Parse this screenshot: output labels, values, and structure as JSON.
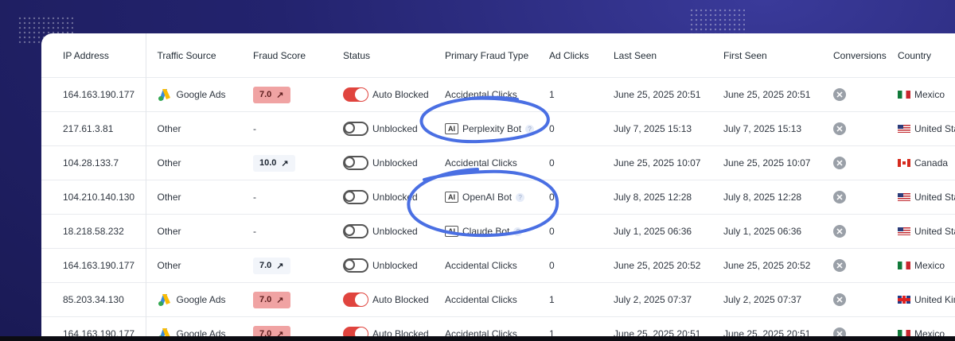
{
  "columns": [
    "IP Address",
    "Traffic Source",
    "Fraud Score",
    "Status",
    "Primary Fraud Type",
    "Ad Clicks",
    "Last Seen",
    "First Seen",
    "Conversions",
    "Country"
  ],
  "rows": [
    {
      "ip": "164.163.190.177",
      "source": "Google Ads",
      "source_icon": "google-ads-icon",
      "score": "7.0",
      "score_level": "high",
      "status": "Auto Blocked",
      "toggle": "on",
      "fraud": "Accidental Clicks",
      "fraud_ai": false,
      "clicks": "1",
      "last": "June 25, 2025 20:51",
      "first": "June 25, 2025 20:51",
      "country": "Mexico",
      "flag": "mx"
    },
    {
      "ip": "217.61.3.81",
      "source": "Other",
      "source_icon": "",
      "score": "-",
      "score_level": "none",
      "status": "Unblocked",
      "toggle": "off",
      "fraud": "Perplexity Bot",
      "fraud_ai": true,
      "clicks": "0",
      "last": "July 7, 2025 15:13",
      "first": "July 7, 2025 15:13",
      "country": "United States",
      "flag": "us"
    },
    {
      "ip": "104.28.133.7",
      "source": "Other",
      "source_icon": "",
      "score": "10.0",
      "score_level": "low",
      "status": "Unblocked",
      "toggle": "off",
      "fraud": "Accidental Clicks",
      "fraud_ai": false,
      "clicks": "0",
      "last": "June 25, 2025 10:07",
      "first": "June 25, 2025 10:07",
      "country": "Canada",
      "flag": "ca"
    },
    {
      "ip": "104.210.140.130",
      "source": "Other",
      "source_icon": "",
      "score": "-",
      "score_level": "none",
      "status": "Unblocked",
      "toggle": "off",
      "fraud": "OpenAI Bot",
      "fraud_ai": true,
      "clicks": "0",
      "last": "July 8, 2025 12:28",
      "first": "July 8, 2025 12:28",
      "country": "United States",
      "flag": "us"
    },
    {
      "ip": "18.218.58.232",
      "source": "Other",
      "source_icon": "",
      "score": "-",
      "score_level": "none",
      "status": "Unblocked",
      "toggle": "off",
      "fraud": "Claude Bot",
      "fraud_ai": true,
      "clicks": "0",
      "last": "July 1, 2025 06:36",
      "first": "July 1, 2025 06:36",
      "country": "United States",
      "flag": "us"
    },
    {
      "ip": "164.163.190.177",
      "source": "Other",
      "source_icon": "",
      "score": "7.0",
      "score_level": "low",
      "status": "Unblocked",
      "toggle": "off",
      "fraud": "Accidental Clicks",
      "fraud_ai": false,
      "clicks": "0",
      "last": "June 25, 2025 20:52",
      "first": "June 25, 2025 20:52",
      "country": "Mexico",
      "flag": "mx"
    },
    {
      "ip": "85.203.34.130",
      "source": "Google Ads",
      "source_icon": "google-ads-icon",
      "score": "7.0",
      "score_level": "high",
      "status": "Auto Blocked",
      "toggle": "on",
      "fraud": "Accidental Clicks",
      "fraud_ai": false,
      "clicks": "1",
      "last": "July 2, 2025 07:37",
      "first": "July 2, 2025 07:37",
      "country": "United Kingdom",
      "flag": "gb"
    },
    {
      "ip": "164.163.190.177",
      "source": "Google Ads",
      "source_icon": "google-ads-icon",
      "score": "7.0",
      "score_level": "high",
      "status": "Auto Blocked",
      "toggle": "on",
      "fraud": "Accidental Clicks",
      "fraud_ai": false,
      "clicks": "1",
      "last": "June 25, 2025 20:51",
      "first": "June 25, 2025 20:51",
      "country": "Mexico",
      "flag": "mx"
    }
  ],
  "ai_tag": "AI",
  "score_arrow_icon": "arrow-up-right-icon",
  "conversion_icon": "x-circle-icon",
  "colors": {
    "accent_red": "#e0443e",
    "annotation_blue": "#4a6fe3",
    "background": "#23236e"
  }
}
